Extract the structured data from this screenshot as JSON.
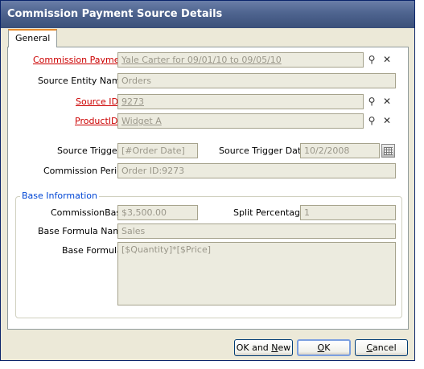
{
  "window": {
    "title": "Commission Payment Source Details",
    "close_glyph": "✕"
  },
  "tabs": [
    {
      "label": "General"
    }
  ],
  "fields": {
    "commission_payment": {
      "label": "Commission Payment",
      "value": "Yale Carter for 09/01/10 to 09/05/10"
    },
    "source_entity_name": {
      "label": "Source Entity Name",
      "value": "Orders"
    },
    "source_id": {
      "label": "Source ID",
      "value": "9273"
    },
    "product_id": {
      "label": "ProductID",
      "value": "Widget A"
    },
    "source_trigger": {
      "label": "Source Trigger",
      "value": "[#Order Date]"
    },
    "source_trigger_date": {
      "label": "Source Trigger Date",
      "value": "10/2/2008"
    },
    "commission_period": {
      "label": "Commission Period",
      "value": "Order ID:9273"
    }
  },
  "base_information": {
    "title": "Base Information",
    "commission_base": {
      "label": "CommissionBase",
      "value": "$3,500.00"
    },
    "split_percentage": {
      "label": "Split Percentage",
      "value": "1"
    },
    "base_formula_name": {
      "label": "Base Formula Name",
      "value": "Sales"
    },
    "base_formula": {
      "label": "Base Formula",
      "value": "[$Quantity]*[$Price]"
    }
  },
  "icons": {
    "find": "binoculars-icon",
    "clear": "clear-x-icon",
    "calendar": "calendar-icon"
  },
  "glyphs": {
    "find": "⚲",
    "clear": "✕"
  },
  "buttons": {
    "ok_and_new": {
      "pre": "OK and ",
      "accel": "N",
      "post": "ew"
    },
    "ok": {
      "pre": "",
      "accel": "O",
      "post": "K"
    },
    "cancel": {
      "pre": "",
      "accel": "C",
      "post": "ancel"
    }
  },
  "colors": {
    "required_label": "#cc0000",
    "group_title": "#0046d5",
    "title_bar": "#4e648f"
  }
}
